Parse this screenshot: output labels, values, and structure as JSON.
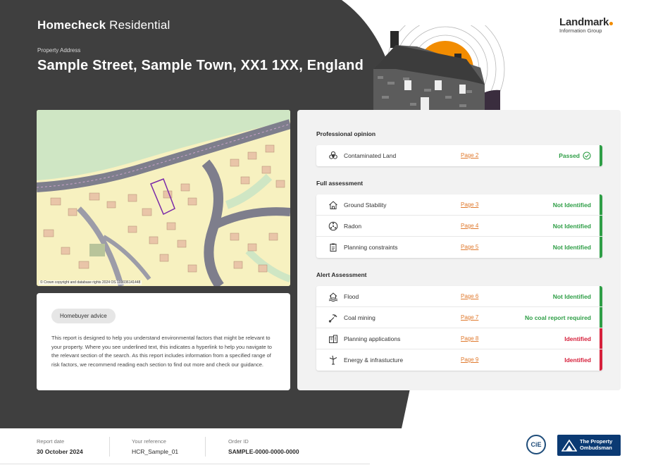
{
  "brand": {
    "part1": "Homecheck",
    "part2": "Residential"
  },
  "property": {
    "label": "Property Address",
    "address": "Sample Street, Sample Town, XX1 1XX, England"
  },
  "logo": {
    "name": "Landmark",
    "sub": "Information Group"
  },
  "map": {
    "copyright": "© Crown copyright and database rights 2024 OS 100036141448"
  },
  "advice": {
    "pill": "Homebuyer advice",
    "text": "This report is designed to help you understand environmental factors that might be relevant to your property. Where you see underlined text, this indicates a hyperlink to help you navigate to the relevant section of the search. As this report includes information from a specified range of risk factors, we recommend reading each section to find out more and check our guidance."
  },
  "sections": [
    {
      "title": "Professional opinion",
      "rows": [
        {
          "label": "Contaminated Land",
          "page": "Page 2",
          "status": "Passed",
          "tone": "green",
          "icon": "biohazard-icon"
        }
      ]
    },
    {
      "title": "Full assessment",
      "rows": [
        {
          "label": "Ground Stability",
          "page": "Page 3",
          "status": "Not Identified",
          "tone": "green",
          "icon": "house-icon"
        },
        {
          "label": "Radon",
          "page": "Page 4",
          "status": "Not Identified",
          "tone": "green",
          "icon": "radon-icon"
        },
        {
          "label": "Planning constraints",
          "page": "Page 5",
          "status": "Not Identified",
          "tone": "green",
          "icon": "clipboard-icon"
        }
      ]
    },
    {
      "title": "Alert Assessment",
      "rows": [
        {
          "label": "Flood",
          "page": "Page 6",
          "status": "Not Identified",
          "tone": "green",
          "icon": "flood-icon"
        },
        {
          "label": "Coal mining",
          "page": "Page 7",
          "status": "No coal report required",
          "tone": "green",
          "icon": "pickaxe-icon"
        },
        {
          "label": "Planning applications",
          "page": "Page 8",
          "status": "Identified",
          "tone": "red",
          "icon": "buildings-icon"
        },
        {
          "label": "Energy & infrastucture",
          "page": "Page 9",
          "status": "Identified",
          "tone": "red",
          "icon": "wind-turbine-icon"
        }
      ]
    }
  ],
  "footer": {
    "report_date_label": "Report date",
    "report_date": "30 October 2024",
    "reference_label": "Your reference",
    "reference": "HCR_Sample_01",
    "order_label": "Order ID",
    "order": "SAMPLE-0000-0000-0000",
    "cie": "CiE",
    "ombudsman": "The Property Ombudsman"
  },
  "colors": {
    "dark_bg": "#3f3f3f",
    "accent_orange": "#f28c00",
    "status_green": "#2e9e46",
    "status_red": "#d6203b",
    "link_orange": "#e07a2e"
  }
}
